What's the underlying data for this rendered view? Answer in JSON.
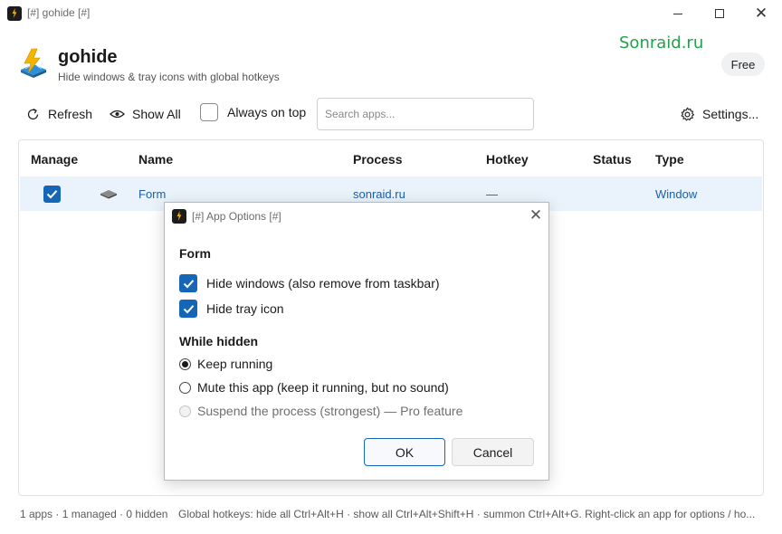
{
  "window": {
    "title": "[#] gohide [#]",
    "controls": {
      "minimize": "minimize",
      "maximize": "maximize",
      "close": "✕"
    }
  },
  "header": {
    "app_name": "gohide",
    "subtitle": "Hide windows & tray icons with global hotkeys",
    "badge": "Free"
  },
  "watermark": "Sonraid.ru",
  "toolbar": {
    "refresh_label": "Refresh",
    "show_all_label": "Show All",
    "always_on_top_label": "Always on top",
    "always_on_top_checked": false,
    "search_placeholder": "Search apps...",
    "search_value": "",
    "settings_label": "Settings..."
  },
  "table": {
    "columns": [
      "Manage",
      "Name",
      "Process",
      "Hotkey",
      "Status",
      "Type"
    ],
    "rows": [
      {
        "managed": true,
        "name": "Form",
        "process": "sonraid.ru",
        "hotkey": "—",
        "status": "",
        "type": "Window",
        "icon": "window-app-icon"
      }
    ]
  },
  "dialog": {
    "title": "[#] App Options [#]",
    "close": "✕",
    "section_app": "Form",
    "options": [
      {
        "label": "Hide windows (also remove from taskbar)",
        "checked": true
      },
      {
        "label": "Hide tray icon",
        "checked": true
      }
    ],
    "while_hidden_label": "While hidden",
    "radios": [
      {
        "label": "Keep running",
        "selected": true,
        "disabled": false
      },
      {
        "label": "Mute this app (keep it running, but no sound)",
        "selected": false,
        "disabled": false
      },
      {
        "label": "Suspend the process (strongest) — Pro feature",
        "selected": false,
        "disabled": true
      }
    ],
    "ok_label": "OK",
    "cancel_label": "Cancel"
  },
  "status_bar": {
    "summary": "1 apps · 1 managed · 0 hidden",
    "hint": "Global hotkeys: hide all Ctrl+Alt+H · show all Ctrl+Alt+Shift+H · summon Ctrl+Alt+G. Right-click an app for options / ho..."
  },
  "colors": {
    "accent": "#1666b8",
    "watermark": "#22a24a",
    "selected_row": "#eaf3fb",
    "link": "#1d5fa8"
  }
}
